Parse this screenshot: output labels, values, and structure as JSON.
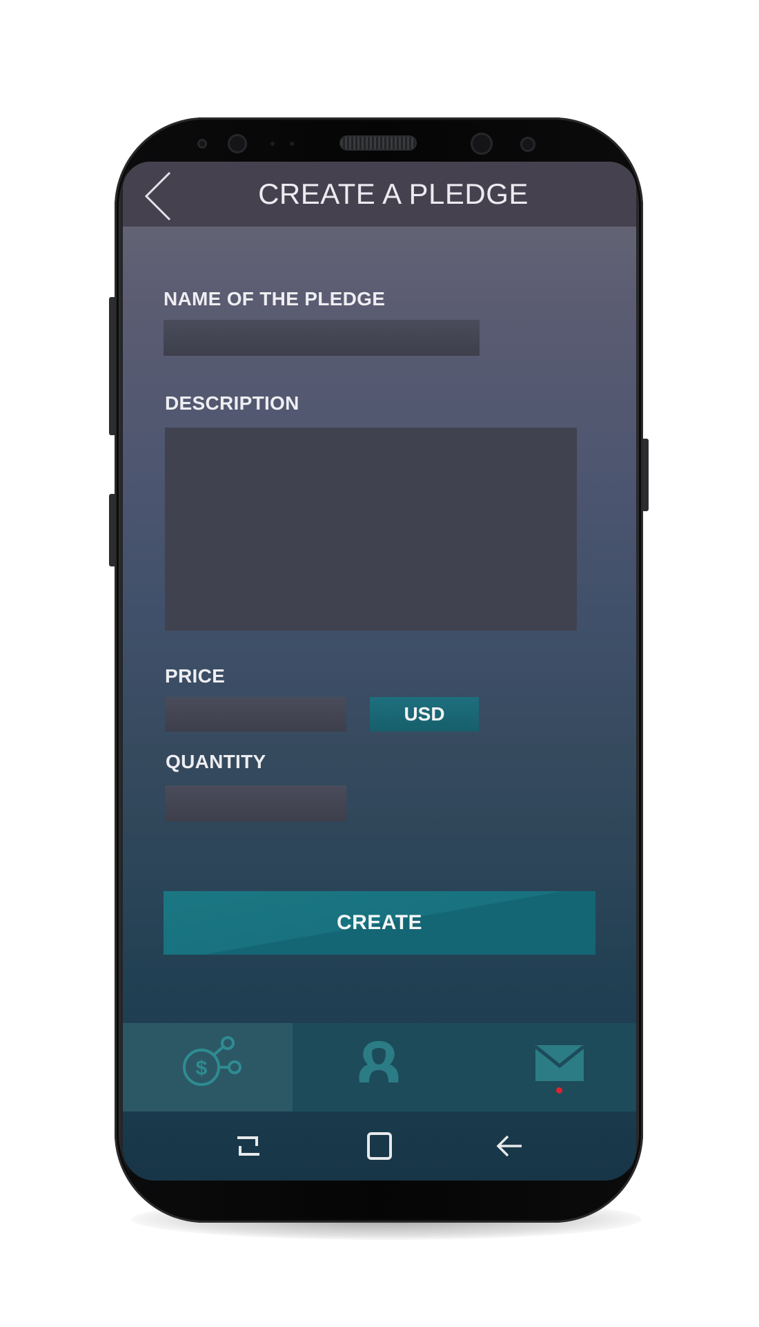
{
  "header": {
    "title": "CREATE A PLEDGE",
    "back_icon": "chevron-left-icon"
  },
  "form": {
    "name_label": "NAME OF THE PLEDGE",
    "name_value": "",
    "description_label": "DESCRIPTION",
    "description_value": "",
    "price_label": "PRICE",
    "price_value": "",
    "currency": "USD",
    "quantity_label": "QUANTITY",
    "quantity_value": "",
    "submit_label": "CREATE"
  },
  "bottom_nav": {
    "items": [
      {
        "icon": "dollar-network-icon",
        "active": true
      },
      {
        "icon": "user-icon",
        "active": false
      },
      {
        "icon": "mail-icon",
        "active": false,
        "notification": true
      }
    ]
  },
  "system_nav": {
    "buttons": [
      "recent-apps-icon",
      "home-icon",
      "back-icon"
    ]
  },
  "colors": {
    "header_bg": "#46414f",
    "accent_teal": "#187280",
    "notification_dot": "#e0242d",
    "nav_bg": "#1d4b5a"
  }
}
